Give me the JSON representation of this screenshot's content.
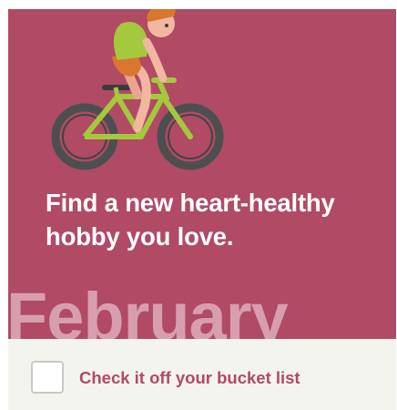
{
  "card": {
    "headline": "Find a new heart-healthy hobby you love.",
    "month": "February",
    "checkbox": {
      "label": "Check it off your bucket list",
      "checked": false
    },
    "illustration_icon": "cyclist-bicycle-icon"
  },
  "colors": {
    "hero_background": "#b04a65",
    "month_text": "#d79fae",
    "footer_background": "#f4f4ef",
    "label_text": "#b04a65",
    "bike_frame": "#a4c93c",
    "tires": "#4b4f4f"
  }
}
